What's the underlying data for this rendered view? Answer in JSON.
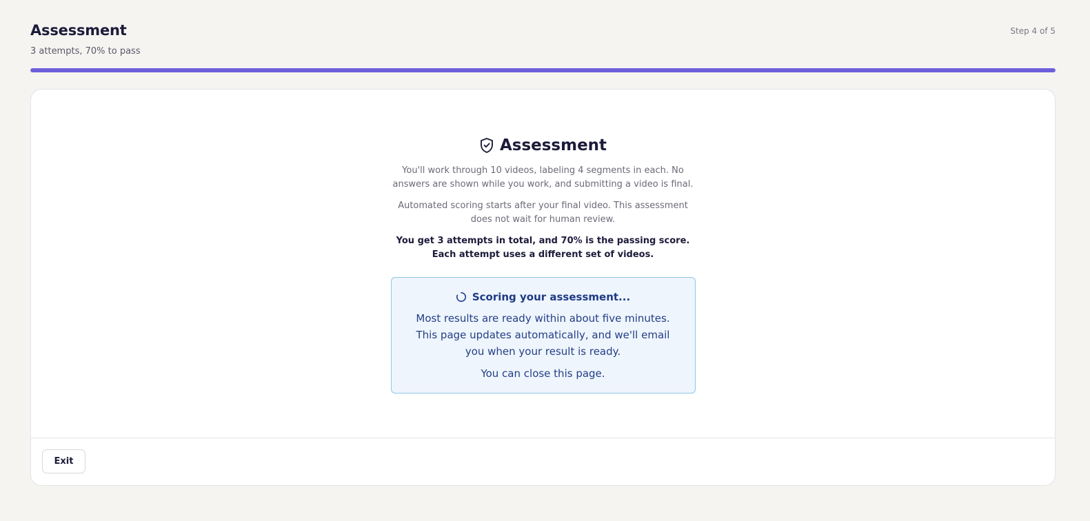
{
  "header": {
    "title": "Assessment",
    "subtitle": "3 attempts, 70% to pass",
    "step": "Step 4 of 5",
    "progress_fraction": 1.0,
    "accent_color": "#6d5fdc"
  },
  "content": {
    "icon": "shield-check-icon",
    "title": "Assessment",
    "paragraphs": [
      "You'll work through 10 videos, labeling 4 segments in each. No answers are shown while you work, and submitting a video is final.",
      "Automated scoring starts after your final video. This assessment does not wait for human review.",
      "You get 3 attempts in total, and 70% is the passing score. Each attempt uses a different set of videos."
    ]
  },
  "status": {
    "icon": "spinner-icon",
    "title": "Scoring your assessment...",
    "message": "Most results are ready within about five minutes. This page updates automatically, and we'll email you when your result is ready.",
    "note": "You can close this page.",
    "background_color": "#eef5fd",
    "border_color": "#8ec8ea"
  },
  "footer": {
    "exit_label": "Exit"
  }
}
